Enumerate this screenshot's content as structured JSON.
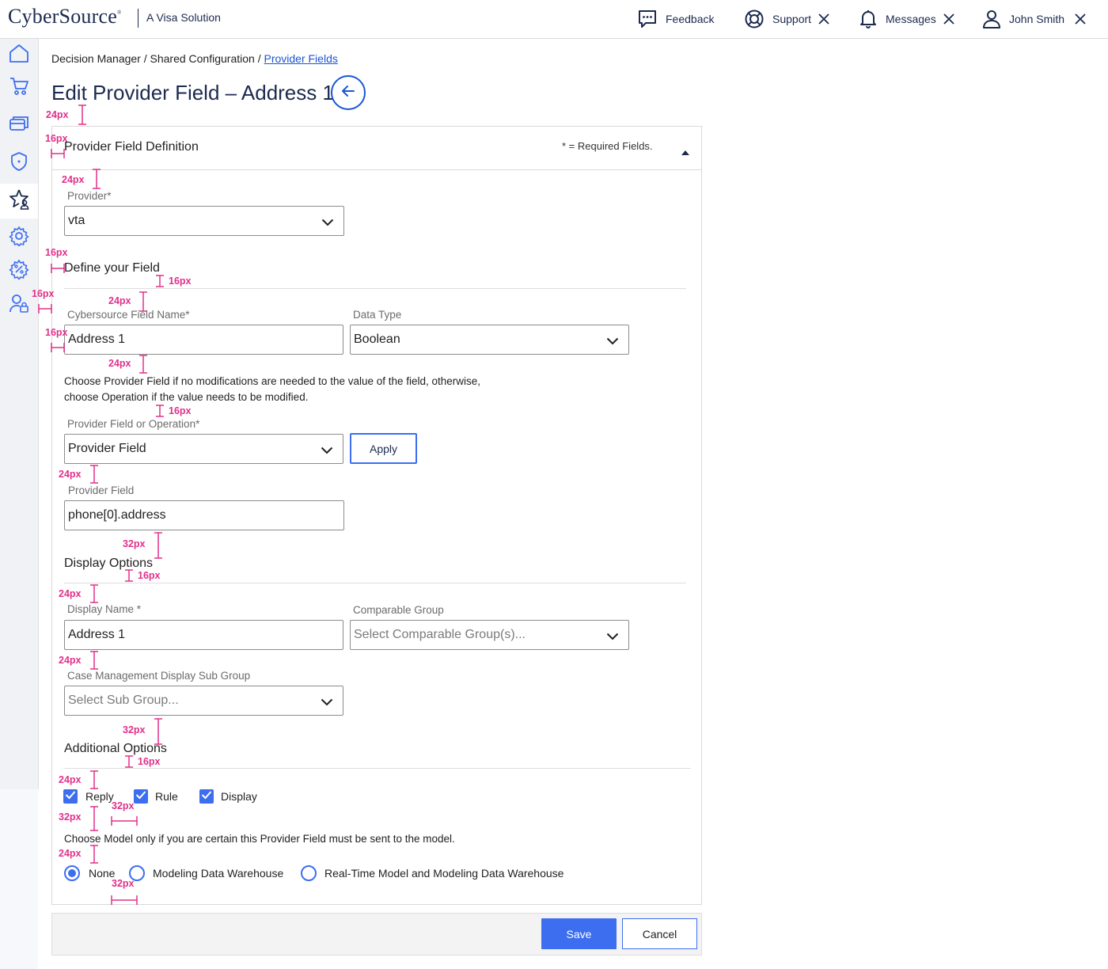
{
  "header": {
    "brand": "CyberSource",
    "brand_mark": "®",
    "tagline": "A Visa Solution",
    "feedback": "Feedback",
    "support": "Support",
    "messages": "Messages",
    "user": "John Smith"
  },
  "sidebar": {
    "items": [
      {
        "icon": "home-icon"
      },
      {
        "icon": "cart-icon"
      },
      {
        "icon": "cards-icon"
      },
      {
        "icon": "shield-icon"
      },
      {
        "icon": "star-person-icon",
        "active": true
      },
      {
        "icon": "gear-icon"
      },
      {
        "icon": "percent-gear-icon"
      },
      {
        "icon": "user-lock-icon"
      }
    ]
  },
  "breadcrumb": {
    "part1": "Decision Manager / Shared Configuration / ",
    "link": "Provider Fields"
  },
  "page_title": "Edit Provider Field – Address 1",
  "card": {
    "heading": "Provider Field Definition",
    "required_note": "* = Required Fields."
  },
  "provider": {
    "label": "Provider*",
    "value": "vta"
  },
  "define_section": "Define your Field",
  "cybersource_field_name": {
    "label": "Cybersource Field Name*",
    "value": "Address 1"
  },
  "data_type": {
    "label": "Data Type",
    "value": "Boolean"
  },
  "choose_note_line1": "Choose Provider Field if no modifications are needed to the value of the field, otherwise,",
  "choose_note_line2": "choose Operation if the value needs to be modified.",
  "provider_field_or_operation": {
    "label": "Provider Field or Operation*",
    "value": "Provider Field"
  },
  "apply_label": "Apply",
  "provider_field": {
    "label": "Provider Field",
    "value": "phone[0].address"
  },
  "display_section": "Display Options",
  "display_name": {
    "label": "Display Name *",
    "value": "Address 1"
  },
  "comparable_group": {
    "label": "Comparable Group",
    "placeholder": "Select Comparable Group(s)..."
  },
  "case_sub_group": {
    "label": "Case Management Display Sub Group",
    "placeholder": "Select Sub Group..."
  },
  "additional_section": "Additional Options",
  "checkboxes": [
    {
      "label": "Reply",
      "checked": true
    },
    {
      "label": "Rule",
      "checked": true
    },
    {
      "label": "Display",
      "checked": true
    }
  ],
  "model_note": "Choose Model only if you are certain this Provider Field must be sent to the model.",
  "radios": [
    {
      "label": "None",
      "selected": true
    },
    {
      "label": "Modeling Data Warehouse",
      "selected": false
    },
    {
      "label": "Real-Time Model and Modeling Data Warehouse",
      "selected": false
    }
  ],
  "footer": {
    "save": "Save",
    "cancel": "Cancel"
  },
  "annotations": {
    "a1": "24px",
    "a2": "16px",
    "a3": "24px",
    "a4": "16px",
    "a5": "16px",
    "a6": "24px",
    "a7": "16px",
    "a8": "16px",
    "a9": "24px",
    "a10": "16px",
    "a11": "24px",
    "a12": "32px",
    "a13": "16px",
    "a14": "24px",
    "a15": "24px",
    "a16": "32px",
    "a17": "16px",
    "a18": "24px",
    "a19": "32px",
    "a20": "32px",
    "a21": "24px",
    "a22": "32px"
  },
  "colors": {
    "accent": "#3d6ef0",
    "title": "#1b2a4e",
    "annotation": "#e0308a",
    "link": "#1a55d6"
  }
}
